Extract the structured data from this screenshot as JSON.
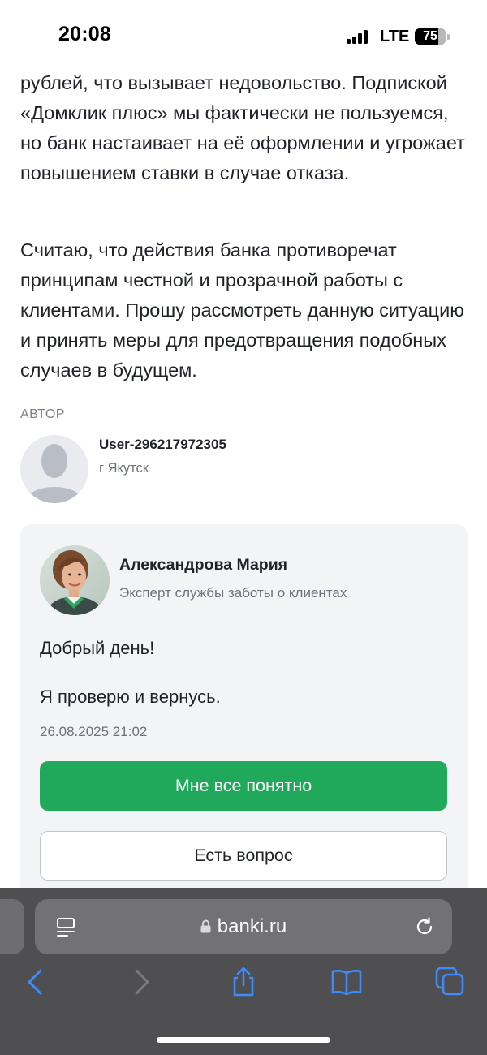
{
  "status_bar": {
    "time": "20:08",
    "network": "LTE",
    "battery_percent": "75"
  },
  "article": {
    "paragraphs": [
      "рублей, что вызывает недовольство. Подпиской «Домклик плюс» мы фактически не пользуемся, но банк настаивает на её оформлении и угрожает повышением ставки в случае отказа.",
      "Считаю, что действия банка противоречат принципам честной и прозрачной работы с клиентами. Прошу рассмотреть данную ситуацию и принять меры для предотвращения подобных случаев в будущем."
    ]
  },
  "author": {
    "label": "АВТОР",
    "name": "User-296217972305",
    "city": "г Якутск"
  },
  "reply": {
    "expert_name": "Александрова Мария",
    "expert_role": "Эксперт службы заботы о клиентах",
    "messages": [
      "Добрый день!",
      "Я проверю и вернусь."
    ],
    "date": "26.08.2025 21:02",
    "primary_button": "Мне все понятно",
    "secondary_button": "Есть вопрос"
  },
  "browser": {
    "url": "banki.ru",
    "accent_color": "#3d8cff"
  },
  "colors": {
    "primary_button": "#21a95b",
    "card_background": "#f3f4f6",
    "browser_bar": "#4f4f51"
  },
  "icons": [
    "signal-icon",
    "battery-icon",
    "tab-menu-icon",
    "lock-icon",
    "reload-icon",
    "back-icon",
    "forward-icon",
    "share-icon",
    "bookmarks-icon",
    "tabs-icon"
  ]
}
